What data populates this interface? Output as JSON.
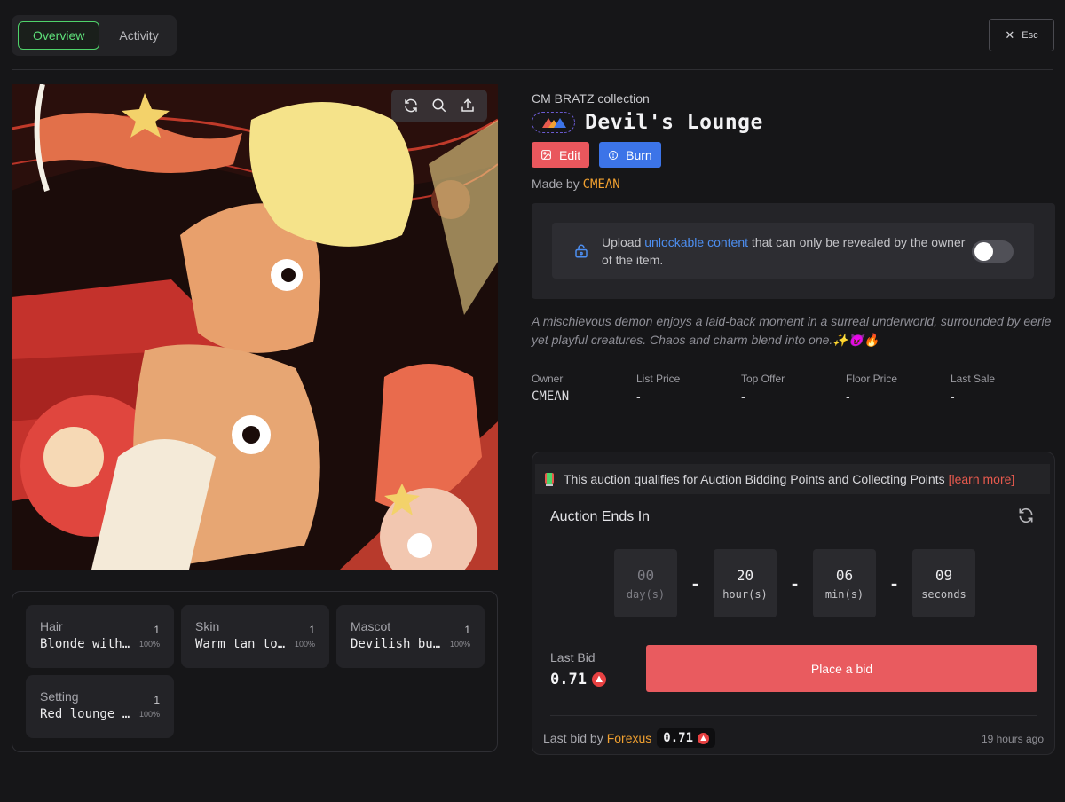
{
  "tabs": [
    {
      "label": "Overview",
      "active": true
    },
    {
      "label": "Activity",
      "active": false
    }
  ],
  "esc_label": "Esc",
  "artwork": {
    "tools": [
      "refresh-icon",
      "search-icon",
      "share-icon"
    ]
  },
  "traits": [
    {
      "name": "Hair",
      "count": "1",
      "value": "Blonde with …",
      "pct": "100%"
    },
    {
      "name": "Skin",
      "count": "1",
      "value": "Warm tan tone",
      "pct": "100%"
    },
    {
      "name": "Mascot",
      "count": "1",
      "value": "Devilish bun…",
      "pct": "100%"
    },
    {
      "name": "Setting",
      "count": "1",
      "value": "Red lounge w…",
      "pct": "100%"
    }
  ],
  "item": {
    "collection": "CM BRATZ collection",
    "title": "Devil's Lounge",
    "edit_label": "Edit",
    "burn_label": "Burn",
    "made_by_prefix": "Made by",
    "creator": "CMEAN",
    "unlock_prefix": "Upload",
    "unlock_link": "unlockable content",
    "unlock_suffix": "that can only be revealed by the owner of the item.",
    "description": "A mischievous demon enjoys a laid-back moment in a surreal underworld, surrounded by eerie yet playful creatures. Chaos and charm blend into one.✨😈🔥"
  },
  "stats": [
    {
      "label": "Owner",
      "value": "CMEAN"
    },
    {
      "label": "List Price",
      "value": "-"
    },
    {
      "label": "Top Offer",
      "value": "-"
    },
    {
      "label": "Floor Price",
      "value": "-"
    },
    {
      "label": "Last Sale",
      "value": "-"
    }
  ],
  "auction": {
    "points_text": "This auction qualifies for Auction Bidding Points and Collecting Points",
    "learn_more": "[learn more]",
    "ends_label": "Auction Ends In",
    "countdown": [
      {
        "num": "00",
        "unit": "day(s)"
      },
      {
        "num": "20",
        "unit": "hour(s)"
      },
      {
        "num": "06",
        "unit": "min(s)"
      },
      {
        "num": "09",
        "unit": "seconds"
      }
    ],
    "separator": "-",
    "last_bid_label": "Last Bid",
    "last_bid_value": "0.71",
    "bid_button": "Place a bid",
    "last_bid_by_prefix": "Last bid by",
    "last_bidder": "Forexus",
    "last_bid_chip": "0.71",
    "time_ago": "19 hours ago"
  },
  "colors": {
    "accent_green": "#5ee07a",
    "danger": "#e9575d",
    "primary": "#3c74e8",
    "highlight": "#f0a030"
  }
}
